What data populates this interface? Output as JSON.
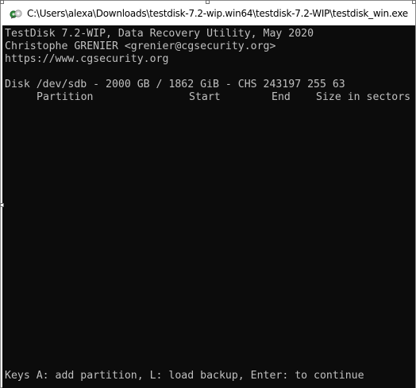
{
  "window": {
    "title": "C:\\Users\\alexa\\Downloads\\testdisk-7.2-wip.win64\\testdisk-7.2-WIP\\testdisk_win.exe",
    "app_icon": "testdisk-icon"
  },
  "console": {
    "background": "#0c0c0c",
    "text_color": "#c0c0c0",
    "header_lines": [
      "TestDisk 7.2-WIP, Data Recovery Utility, May 2020",
      "Christophe GRENIER <grenier@cgsecurity.org>",
      "https://www.cgsecurity.org"
    ],
    "disk_line": "Disk /dev/sdb - 2000 GB / 1862 GiB - CHS 243197 255 63",
    "columns": {
      "partition": "Partition",
      "start": "Start",
      "end": "End",
      "size": "Size in sectors"
    },
    "keys_line": "Keys A: add partition, L: load backup, Enter: to continue"
  }
}
